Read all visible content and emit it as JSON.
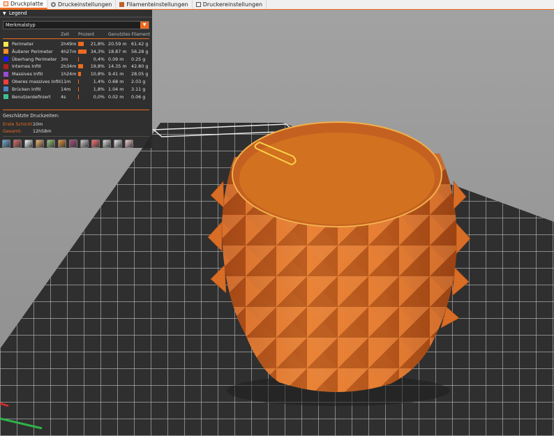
{
  "tabs": [
    {
      "label": "Druckplatte",
      "icon": "plate-icon",
      "active": true
    },
    {
      "label": "Druckeinstellungen",
      "icon": "gear-icon",
      "active": false
    },
    {
      "label": "Filamenteinstellungen",
      "icon": "spool-icon",
      "active": false
    },
    {
      "label": "Druckereinstellungen",
      "icon": "printer-icon",
      "active": false
    }
  ],
  "legend": {
    "title": "Legend",
    "view_type": "Merkmalstyp",
    "columns": {
      "time": "Zeit",
      "percent": "Prozent",
      "filament": "Genutztes Filament"
    },
    "items": [
      {
        "name": "Perimeter",
        "color": "#ffe74f",
        "time": "2h49m",
        "percent": "21,8%",
        "percent_value": 0.218,
        "length": "20.59 m",
        "weight": "61.42 g"
      },
      {
        "name": "Äußerer Perimeter",
        "color": "#ff8c2a",
        "time": "4h27m",
        "percent": "34,3%",
        "percent_value": 0.343,
        "length": "18.87 m",
        "weight": "56.28 g"
      },
      {
        "name": "Überhang Perimeter",
        "color": "#1a1aff",
        "time": "3m",
        "percent": "0,4%",
        "percent_value": 0.004,
        "length": "0.09 m",
        "weight": "0.25 g"
      },
      {
        "name": "Internes Infill",
        "color": "#b21f1f",
        "time": "2h34m",
        "percent": "19,8%",
        "percent_value": 0.198,
        "length": "14.35 m",
        "weight": "42.80 g"
      },
      {
        "name": "Massives Infill",
        "color": "#9a4bd6",
        "time": "1h24m",
        "percent": "10,8%",
        "percent_value": 0.108,
        "length": "9.41 m",
        "weight": "28.05 g"
      },
      {
        "name": "Oberes massives Infill",
        "color": "#f03c3c",
        "time": "11m",
        "percent": "1,4%",
        "percent_value": 0.014,
        "length": "0.68 m",
        "weight": "2.03 g"
      },
      {
        "name": "Brücken Infill",
        "color": "#4d84c4",
        "time": "14m",
        "percent": "1,8%",
        "percent_value": 0.018,
        "length": "1.04 m",
        "weight": "3.11 g"
      },
      {
        "name": "Benutzerdefiniert",
        "color": "#3fbf8f",
        "time": "4s",
        "percent": "0,0%",
        "percent_value": 0.0,
        "length": "0.02 m",
        "weight": "0.06 g"
      }
    ],
    "estimated_title": "Geschätzte Druckzeiten:",
    "first_layer_label": "Erste Schicht:",
    "first_layer_value": "10m",
    "total_label": "Gesamt:",
    "total_value": "12h58m",
    "toolbar_icons": [
      "travel-icon",
      "wipe-icon",
      "retractions-icon",
      "deretractions-icon",
      "seams-icon",
      "tool-changes-icon",
      "color-changes-icon",
      "pause-icon",
      "custom-gcode-icon",
      "center-of-gravity-icon",
      "shells-icon",
      "tool-marker-icon"
    ]
  },
  "colors": {
    "accent": "#ed6b21",
    "model": "#d9691f"
  }
}
